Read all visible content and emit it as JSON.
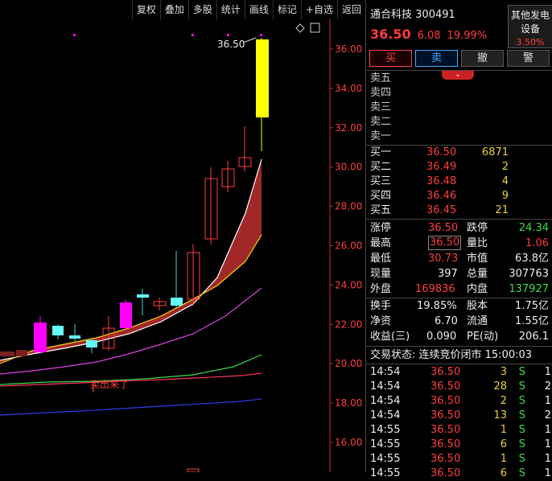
{
  "toolbar": {
    "items": [
      "复权",
      "叠加",
      "多股",
      "统计",
      "画线",
      "标记",
      "+自选",
      "返回"
    ]
  },
  "chart": {
    "high_label": "36.50",
    "note_label": "卖出来了",
    "y_axis": [
      "36.00",
      "34.00",
      "32.00",
      "30.00",
      "28.00",
      "26.00",
      "24.00",
      "22.00",
      "20.00",
      "18.00",
      "16.00"
    ]
  },
  "stock": {
    "name": "通合科技",
    "code": "300491",
    "price": "36.50",
    "change": "6.08",
    "change_pct": "19.99%"
  },
  "other_device": {
    "line1": "其他发电",
    "line2": "设备",
    "pct": "3.50%"
  },
  "trade_buttons": {
    "buy": "买",
    "sell": "卖",
    "cancel": "撤",
    "alert": "警"
  },
  "expand_glyph": "⌄",
  "asks": [
    {
      "label": "卖五",
      "price": "",
      "vol": ""
    },
    {
      "label": "卖四",
      "price": "",
      "vol": ""
    },
    {
      "label": "卖三",
      "price": "",
      "vol": ""
    },
    {
      "label": "卖二",
      "price": "",
      "vol": ""
    },
    {
      "label": "卖一",
      "price": "",
      "vol": ""
    }
  ],
  "bids": [
    {
      "label": "买一",
      "price": "36.50",
      "vol": "6871"
    },
    {
      "label": "买二",
      "price": "36.49",
      "vol": "2"
    },
    {
      "label": "买三",
      "price": "36.48",
      "vol": "4"
    },
    {
      "label": "买四",
      "price": "36.46",
      "vol": "9"
    },
    {
      "label": "买五",
      "price": "36.45",
      "vol": "21"
    }
  ],
  "stats1": [
    {
      "l1": "涨停",
      "v1": "36.50",
      "l2": "跌停",
      "v2": "24.34"
    },
    {
      "l1": "最高",
      "v1": "36.50",
      "l2": "量比",
      "v2": "1.06"
    },
    {
      "l1": "最低",
      "v1": "30.73",
      "l2": "市值",
      "v2": "63.8亿"
    },
    {
      "l1": "现量",
      "v1": "397",
      "l2": "总量",
      "v2": "307763"
    },
    {
      "l1": "外盘",
      "v1": "169836",
      "l2": "内盘",
      "v2": "137927"
    }
  ],
  "stats2": [
    {
      "l1": "换手",
      "v1": "19.85%",
      "l2": "股本",
      "v2": "1.75亿"
    },
    {
      "l1": "净资",
      "v1": "6.70",
      "l2": "流通",
      "v2": "1.55亿"
    },
    {
      "l1": "收益(三)",
      "v1": "0.090",
      "l2": "PE(动)",
      "v2": "206.1"
    }
  ],
  "trade_status": "交易状态: 连续竞价闭市 15:00:03",
  "ticks": [
    {
      "time": "14:54",
      "price": "36.50",
      "vol": "3",
      "side": "S",
      "n": "1"
    },
    {
      "time": "14:54",
      "price": "36.50",
      "vol": "28",
      "side": "S",
      "n": "2"
    },
    {
      "time": "14:54",
      "price": "36.50",
      "vol": "2",
      "side": "S",
      "n": "1"
    },
    {
      "time": "14:54",
      "price": "36.50",
      "vol": "13",
      "side": "S",
      "n": "2"
    },
    {
      "time": "14:55",
      "price": "36.50",
      "vol": "1",
      "side": "S",
      "n": "1"
    },
    {
      "time": "14:55",
      "price": "36.50",
      "vol": "6",
      "side": "S",
      "n": "1"
    },
    {
      "time": "14:55",
      "price": "36.50",
      "vol": "1",
      "side": "S",
      "n": "1"
    },
    {
      "time": "14:55",
      "price": "36.50",
      "vol": "6",
      "side": "S",
      "n": "1"
    }
  ],
  "colors": {
    "up": "#ff3d3d",
    "down": "#3ddc4a",
    "axis": "#c03030"
  }
}
